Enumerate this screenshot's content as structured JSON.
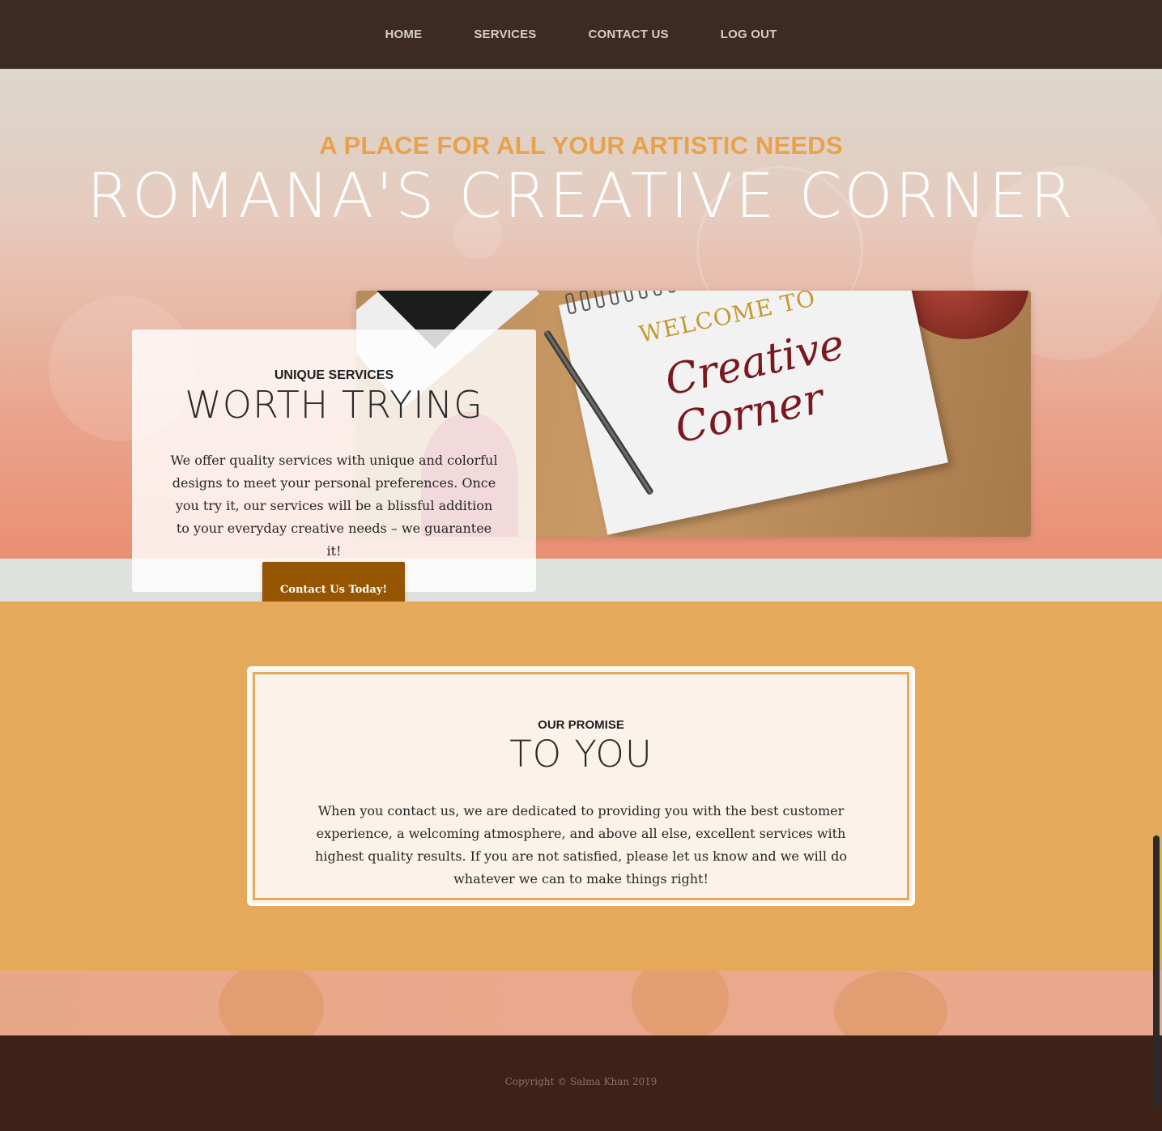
{
  "nav": {
    "items": [
      {
        "label": "HOME"
      },
      {
        "label": "SERVICES"
      },
      {
        "label": "CONTACT US"
      },
      {
        "label": "LOG OUT"
      }
    ]
  },
  "hero": {
    "tagline": "A PLACE FOR ALL YOUR ARTISTIC NEEDS",
    "title": "ROMANA'S CREATIVE CORNER",
    "photo": {
      "line1": "WELCOME TO",
      "line2": "Creative Corner"
    }
  },
  "services": {
    "eyebrow": "UNIQUE SERVICES",
    "heading": "WORTH TRYING",
    "body": "We offer quality services with unique and colorful designs to meet your personal preferences. Once you try it, our services will be a blissful addition to your everyday creative needs – we guarantee it!",
    "cta_label": "Contact Us Today!"
  },
  "promise": {
    "eyebrow": "OUR PROMISE",
    "heading": "TO YOU",
    "body": "When you contact us, we are dedicated to providing you with the best customer experience, a welcoming atmosphere, and above all else, excellent services with highest quality results. If you are not satisfied, please let us know and we will do whatever we can to make things right!"
  },
  "footer": {
    "copyright": "Copyright © Salma Khan 2019"
  },
  "colors": {
    "nav_bg": "#3d2a21",
    "accent_orange": "#e6a24c",
    "cta_bg": "#965501",
    "promise_bg": "#e5a95c",
    "footer_bg": "#3e2218"
  }
}
